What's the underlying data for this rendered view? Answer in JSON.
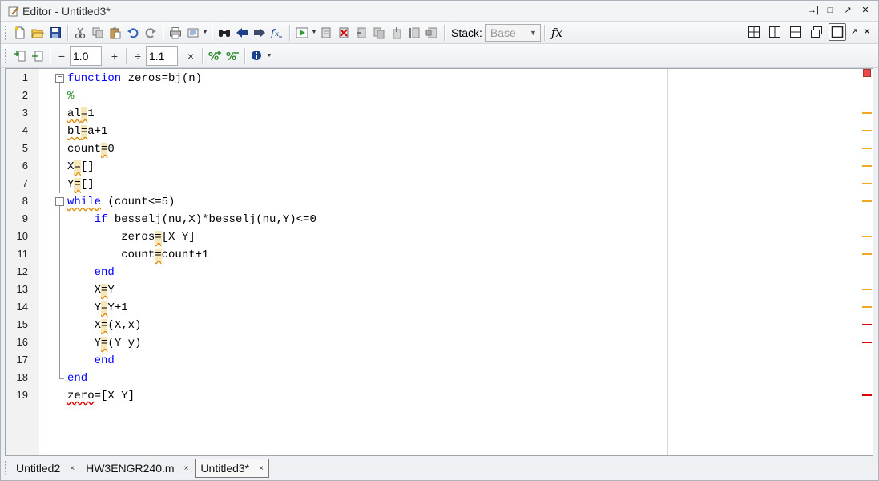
{
  "window": {
    "title": "Editor - Untitled3*"
  },
  "title_controls": [
    {
      "name": "undock-icon",
      "glyph": "→|"
    },
    {
      "name": "minimize-icon",
      "glyph": "□"
    },
    {
      "name": "maximize-icon",
      "glyph": "↗"
    },
    {
      "name": "close-icon",
      "glyph": "✕"
    }
  ],
  "toolbar": {
    "stack_label": "Stack:",
    "stack_value": "Base",
    "fx_label": "fx"
  },
  "cell_toolbar": {
    "minus": "−",
    "increment_value": "1.0",
    "plus": "+",
    "divide": "÷",
    "factor_value": "1.1",
    "times": "×"
  },
  "editor": {
    "line_numbers": [
      "1",
      "2",
      "3",
      "4",
      "5",
      "6",
      "7",
      "8",
      "9",
      "10",
      "11",
      "12",
      "13",
      "14",
      "15",
      "16",
      "17",
      "18",
      "19"
    ],
    "lines": [
      "function zeros=bj(n)",
      "%",
      "al=1",
      "bl=a+1",
      "count=0",
      "X=[]",
      "Y=[]",
      "while (count<=5)",
      "    if besselj(nu,X)*besselj(nu,Y)<=0",
      "        zeros=[X Y]",
      "        count=count+1",
      "    end",
      "    X=Y",
      "    Y=Y+1",
      "    X=(X,x)",
      "    Y=(Y y)",
      "    end",
      "end",
      "zero=[X Y]"
    ]
  },
  "markers": {
    "warning_color": "#f5a623",
    "error_color": "#e00000"
  },
  "tabs": [
    {
      "label": "Untitled2",
      "close": "×",
      "active": false
    },
    {
      "label": "HW3ENGR240.m",
      "close": "×",
      "active": false
    },
    {
      "label": "Untitled3*",
      "close": "×",
      "active": true
    }
  ]
}
